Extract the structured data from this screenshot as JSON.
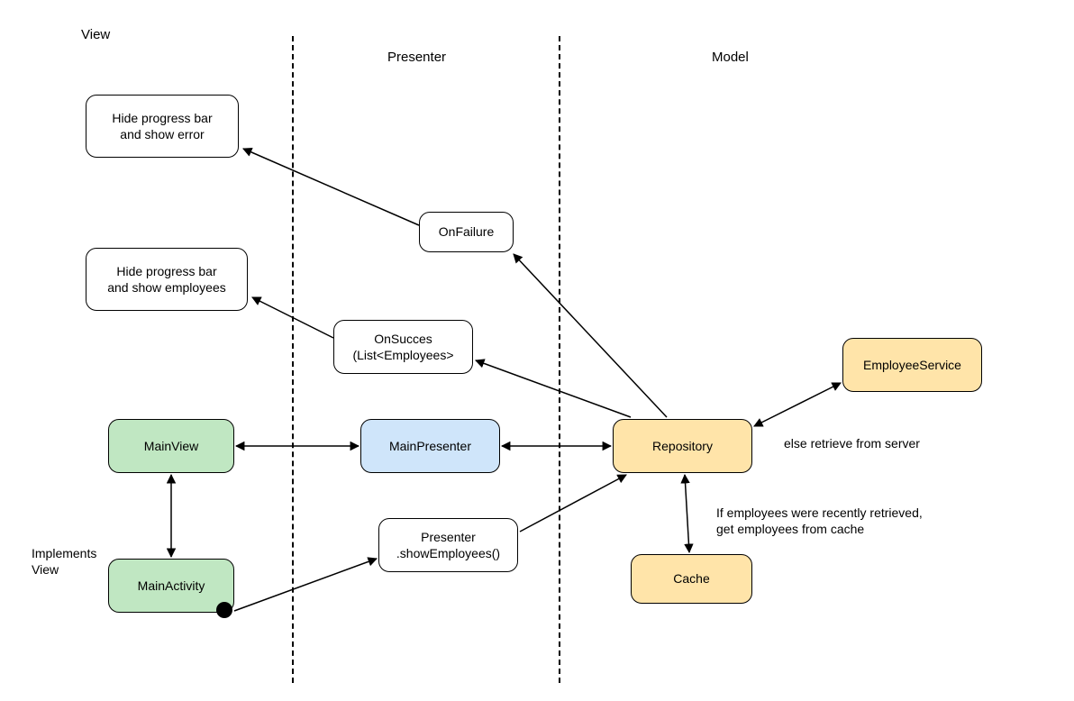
{
  "sections": {
    "view": "View",
    "presenter": "Presenter",
    "model": "Model"
  },
  "boxes": {
    "hideError": "Hide progress bar\nand show error",
    "hideEmployees": "Hide progress bar\nand show employees",
    "onFailure": "OnFailure",
    "onSuccess": "OnSucces\n(List<Employees>",
    "mainView": "MainView",
    "mainActivity": "MainActivity",
    "mainPresenter": "MainPresenter",
    "presenterShow": "Presenter\n.showEmployees()",
    "repository": "Repository",
    "cache": "Cache",
    "employeeService": "EmployeeService"
  },
  "notes": {
    "implementsView": "Implements\nView",
    "elseRetrieve": "else retrieve from server",
    "ifRecent": "If employees were recently retrieved,\nget employees from cache"
  }
}
